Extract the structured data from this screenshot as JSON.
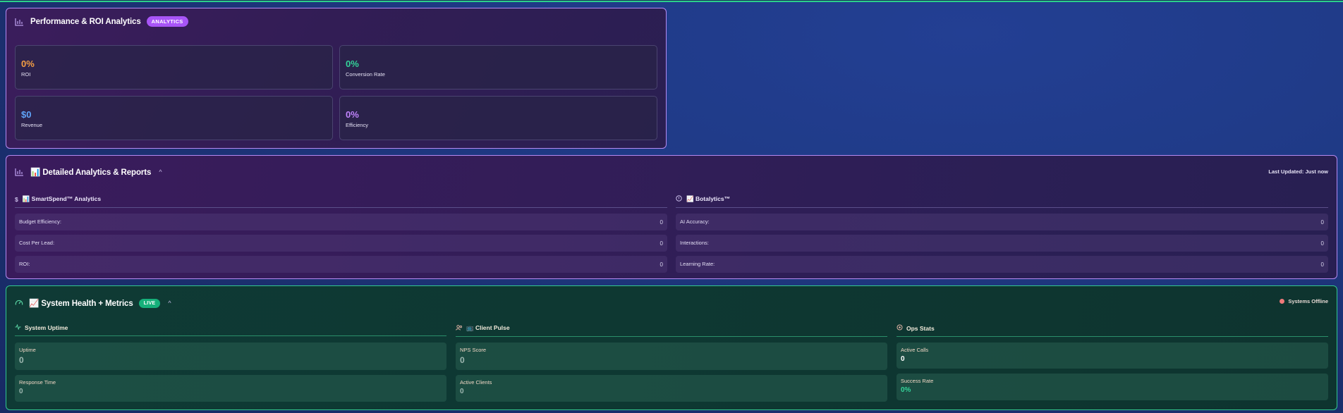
{
  "performance": {
    "title": "Performance & ROI Analytics",
    "badge": "ANALYTICS",
    "tiles": [
      {
        "value": "0%",
        "label": "ROI",
        "color": "#f59e43"
      },
      {
        "value": "0%",
        "label": "Conversion Rate",
        "color": "#34d399"
      },
      {
        "value": "$0",
        "label": "Revenue",
        "color": "#60a5fa"
      },
      {
        "value": "0%",
        "label": "Efficiency",
        "color": "#c084fc"
      }
    ]
  },
  "detailed": {
    "title": "📊 Detailed Analytics & Reports",
    "caret": "^",
    "last_updated": "Last Updated: Just now",
    "smartspend": {
      "icon_glyph": "$",
      "title": "📊 SmartSpend™ Analytics",
      "rows": [
        {
          "label": "Budget Efficiency:",
          "value": "0"
        },
        {
          "label": "Cost Per Lead:",
          "value": "0"
        },
        {
          "label": "ROI:",
          "value": "0"
        }
      ]
    },
    "botalytics": {
      "title": "📈 Botalytics™",
      "rows": [
        {
          "label": "AI Accuracy:",
          "value": "0"
        },
        {
          "label": "Interactions:",
          "value": "0"
        },
        {
          "label": "Learning Rate:",
          "value": "0"
        }
      ]
    }
  },
  "health": {
    "title": "📈 System Health + Metrics",
    "badge": "LIVE",
    "caret": "^",
    "status": "Systems Offline",
    "status_color": "#f07a7a",
    "uptime": {
      "title": "System Uptime",
      "cards": [
        {
          "label": "Uptime",
          "value": "0"
        },
        {
          "label": "Response Time",
          "value": "0"
        }
      ]
    },
    "client_pulse": {
      "title": "📺 Client Pulse",
      "cards": [
        {
          "label": "NPS Score",
          "value": "0"
        },
        {
          "label": "Active Clients",
          "value": "0"
        }
      ]
    },
    "ops": {
      "title": "Ops Stats",
      "cards": [
        {
          "label": "Active Calls",
          "value": "0",
          "color": "#ffffff"
        },
        {
          "label": "Success Rate",
          "value": "0%",
          "color": "#34d399"
        }
      ]
    }
  }
}
